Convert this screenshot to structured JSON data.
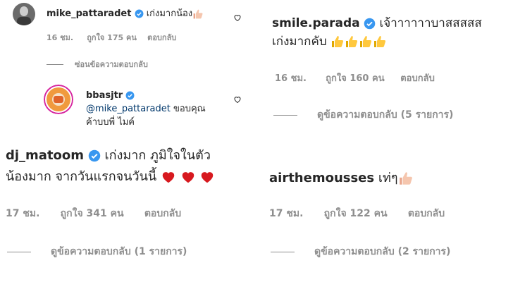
{
  "panels": {
    "top_left": {
      "comment": {
        "username": "mike_pattaradet",
        "text": "เก่งมากน้อง",
        "time": "16 ชม.",
        "likes": "ถูกใจ 175 คน",
        "reply": "ตอบกลับ"
      },
      "hide_replies": "ซ่อนข้อความตอบกลับ",
      "reply_comment": {
        "username": "bbasjtr",
        "mention": "@mike_pattaradet",
        "text_line1": " ขอบคุณ",
        "text_line2": "ค้าบบพี่ ไมค์"
      }
    },
    "top_right": {
      "comment": {
        "username": "smile.parada",
        "text_line1": "เจ้าาาาาาบาสสสสส",
        "text_line2": "เก่งมากคับ",
        "time": "16 ชม.",
        "likes": "ถูกใจ 160 คน",
        "reply": "ตอบกลับ"
      },
      "view_replies": "ดูข้อความตอบกลับ (5 รายการ)"
    },
    "bottom_left": {
      "comment": {
        "username": "dj_matoom",
        "text_line1": "เก่งมาก ภูมิใจในตัว",
        "text_line2": "น้องมาก จากวันแรกจนวันนี้",
        "time": "17 ชม.",
        "likes": "ถูกใจ 341 คน",
        "reply": "ตอบกลับ"
      },
      "view_replies": "ดูข้อความตอบกลับ (1 รายการ)"
    },
    "bottom_right": {
      "comment": {
        "username": "airthemousses",
        "text": "เท่ๆ",
        "time": "17 ชม.",
        "likes": "ถูกใจ 122 คน",
        "reply": "ตอบกลับ"
      },
      "view_replies": "ดูข้อความตอบกลับ (2 รายการ)"
    }
  },
  "colors": {
    "text": "#262626",
    "meta": "#8e8e8e",
    "verified": "#3897f0",
    "mention": "#00376b",
    "heart_red": "#d7191f",
    "thumb": "#ffc83d"
  },
  "icons": [
    "verified-badge-icon",
    "heart-outline-icon",
    "thumbs-up-emoji",
    "red-heart-emoji"
  ]
}
